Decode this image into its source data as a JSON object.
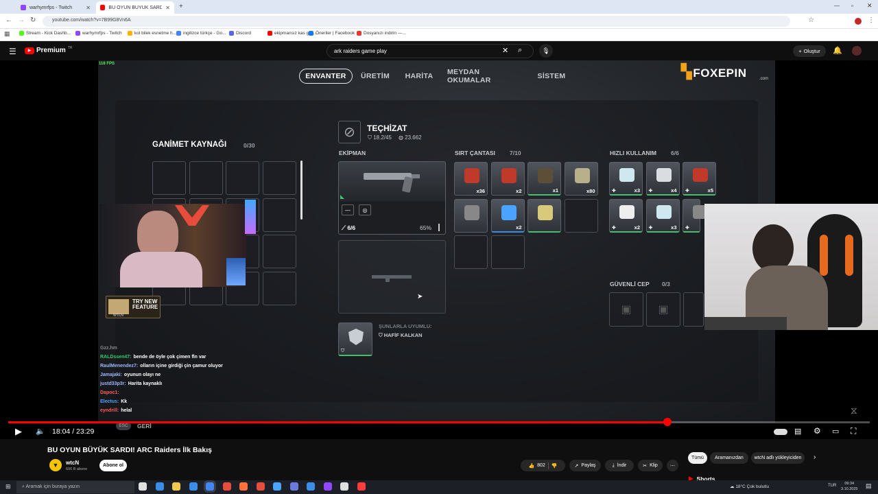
{
  "browser": {
    "tabs": [
      {
        "title": "warhymrfps - Twitch",
        "color": "#9146ff",
        "active": false
      },
      {
        "title": "BU OYUN BÜYÜK SARDI! ARC R",
        "color": "#ff0000",
        "active": true
      }
    ],
    "url": "youtube.com/watch?v=7B99G8Vn6A",
    "bookmarks": [
      {
        "label": "Stream - Kick Dashb...",
        "color": "#53fc18"
      },
      {
        "label": "warhymrfps - Twitch",
        "color": "#9146ff"
      },
      {
        "label": "kol bilek esnetme h...",
        "color": "#ffb300"
      },
      {
        "label": "ingilizce türkçe - Go...",
        "color": "#4285f4"
      },
      {
        "label": "Discord",
        "color": "#5865f2"
      },
      {
        "label": "ekipmansız kas geli...",
        "color": "#ff0000"
      },
      {
        "label": "Öneriler | Facebook",
        "color": "#1877f2"
      },
      {
        "label": "Dosyanızı indirin —...",
        "color": "#e53935"
      }
    ]
  },
  "youtube": {
    "logo": "Premium",
    "logo_region": "TR",
    "search_value": "ark raiders game play",
    "create_label": "Oluştur"
  },
  "game": {
    "fps": "118 FPS",
    "nav": [
      "ENVANTER",
      "ÜRETİM",
      "HARİTA",
      "MEYDAN OKUMALAR",
      "SİSTEM"
    ],
    "sponsor": "FOXEPIN",
    "sponsor_suffix": ".com",
    "loot_title": "GANİMET KAYNAĞI",
    "loot_count": "0/30",
    "equipment_title": "TEÇHİZAT",
    "weight": "18.2/45",
    "money": "23.662",
    "equip_label": "EKİPMAN",
    "weapon_ammo": "6/6",
    "weapon_durability": "65%",
    "backpack_label": "SIRT ÇANTASI",
    "backpack_count": "7/10",
    "backpack_qty": [
      "x36",
      "x2",
      "x1",
      "x80",
      "",
      "x2",
      "",
      ""
    ],
    "quick_label": "HIZLI KULLANIM",
    "quick_count": "6/6",
    "quick_qty": [
      "x3",
      "x4",
      "x5",
      "x2",
      "x3",
      ""
    ],
    "safe_label": "GÜVENLİ CEP",
    "safe_count": "0/3",
    "compatible_label": "ŞUNLARLA UYUMLU:",
    "compatible_item": "HAFİF KALKAN",
    "esc_key": "ESC",
    "back_label": "GERİ"
  },
  "overlay": {
    "try_new": "TRY NEW",
    "feature": "FEATURE",
    "brand": "WTCN"
  },
  "chat": [
    {
      "user": "Gzz.hm",
      "msg": "",
      "color": "#888888"
    },
    {
      "user": "RALDssen47:",
      "msg": "bende de öyle çok çimen fln var",
      "color": "#2ecc71"
    },
    {
      "user": "RaulMenendez7:",
      "msg": "olların içine girdiği çin çamur oluyor",
      "color": "#9fb7ff"
    },
    {
      "user": "Jamajaki:",
      "msg": "oyunun olayı ne",
      "color": "#9fb7ff"
    },
    {
      "user": "justd33p3r:",
      "msg": "Harita kaynaklı",
      "color": "#9fb7ff"
    },
    {
      "user": "Dapoc1:",
      "msg": "",
      "color": "#ff5a5a"
    },
    {
      "user": "Electus:",
      "msg": "Kk",
      "color": "#4aa3ff"
    },
    {
      "user": "eyndrill:",
      "msg": "helal",
      "color": "#ff5a5a"
    }
  ],
  "player": {
    "current_time": "18:04",
    "duration": "23:29",
    "progress": 0.765
  },
  "video": {
    "title": "BU OYUN BÜYÜK SARDI! ARC Raiders İlk Bakış",
    "channel": "wtcN",
    "subscribers": "606 B abone",
    "subscribe_label": "Abone ol",
    "likes": "802",
    "share_label": "Paylaş",
    "download_label": "İndir",
    "clip_label": "Klip"
  },
  "sidebar": {
    "chips": [
      "Tümü",
      "Aramanızdan",
      "wtcN adlı yükleyiciden"
    ],
    "shorts_label": "Shorts"
  },
  "taskbar": {
    "search_placeholder": "Aramak için buraya yazın",
    "weather": "18°C  Çok bulutlu",
    "lang": "TUR",
    "time": "09:34",
    "date": "3.10.2025"
  }
}
